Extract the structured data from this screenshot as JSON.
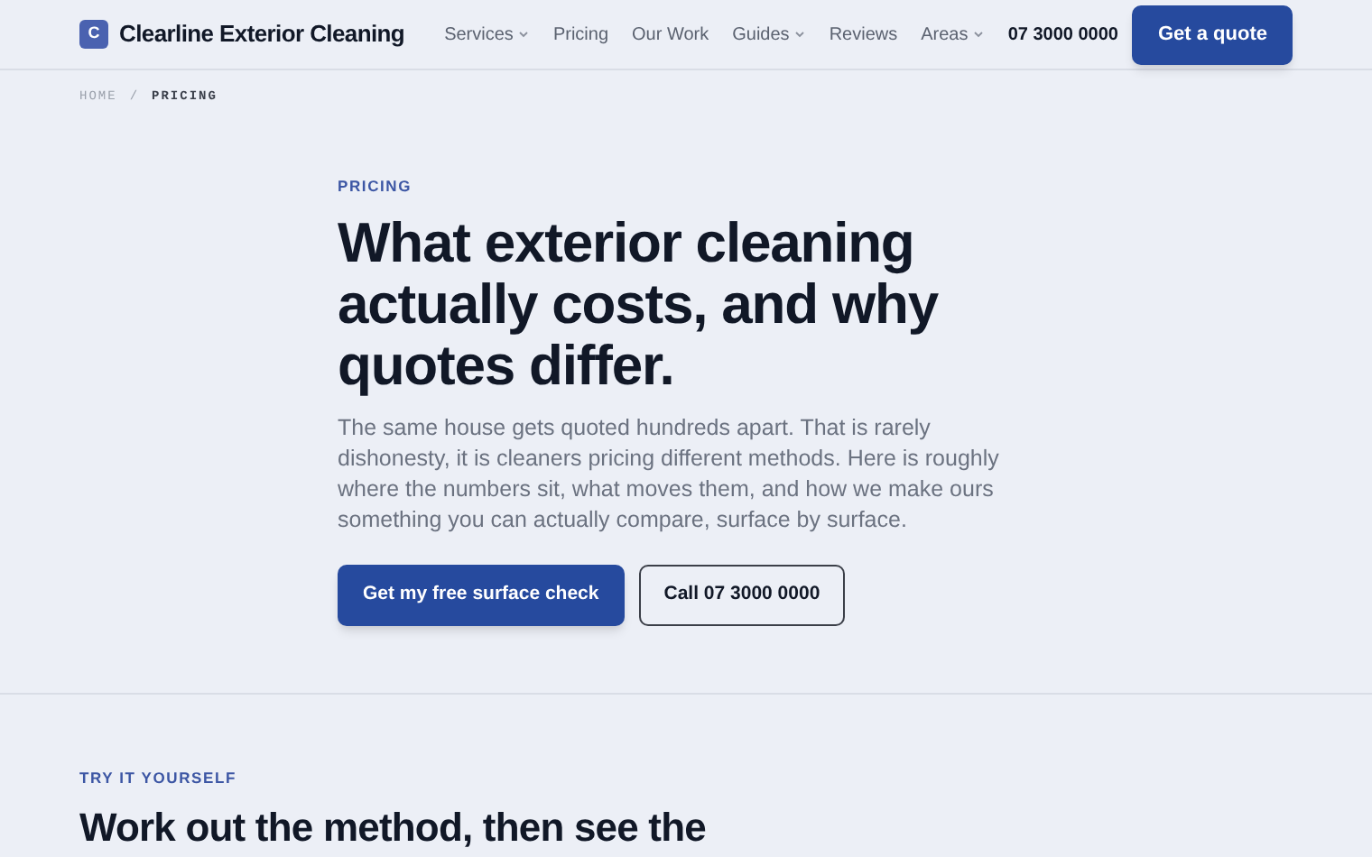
{
  "header": {
    "logo_letter": "C",
    "brand": "Clearline Exterior Cleaning",
    "nav": [
      {
        "label": "Services",
        "has_menu": true
      },
      {
        "label": "Pricing",
        "has_menu": false
      },
      {
        "label": "Our Work",
        "has_menu": false
      },
      {
        "label": "Guides",
        "has_menu": true
      },
      {
        "label": "Reviews",
        "has_menu": false
      },
      {
        "label": "Areas",
        "has_menu": true
      }
    ],
    "phone": "07 3000 0000",
    "cta": "Get a quote"
  },
  "breadcrumb": [
    "HOME",
    "/",
    "PRICING"
  ],
  "hero": {
    "eyebrow": "PRICING",
    "title": "What exterior cleaning actually costs, and why quotes differ.",
    "body": "The same house gets quoted hundreds apart. That is rarely dishonesty, it is cleaners pricing different methods. Here is roughly where the numbers sit, what moves them, and how we make ours something you can actually compare, surface by surface.",
    "primary_button": "Get my free surface check",
    "secondary_button": "Call 07 3000 0000"
  },
  "next_section": {
    "eyebrow": "TRY IT YOURSELF",
    "title": "Work out the method, then see the"
  }
}
